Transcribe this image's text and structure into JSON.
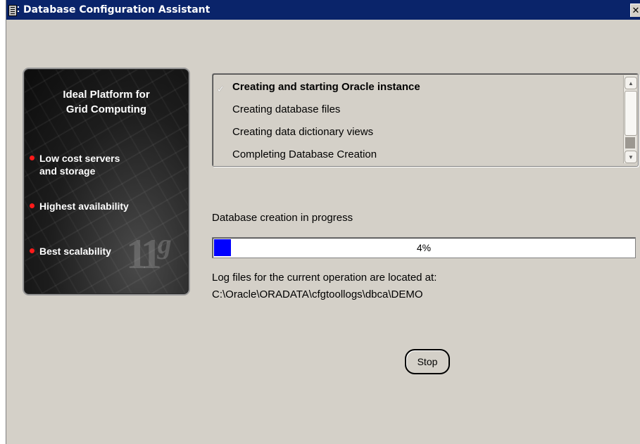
{
  "window": {
    "title": "Database Configuration Assistant",
    "close_glyph": "✕"
  },
  "promo": {
    "title_line1": "Ideal Platform for",
    "title_line2": "Grid Computing",
    "bullets": [
      {
        "line1": "Low cost servers",
        "line2": "and storage"
      },
      {
        "line1": "Highest availability",
        "line2": ""
      },
      {
        "line1": "Best scalability",
        "line2": ""
      }
    ],
    "logo_main": "11",
    "logo_sup": "g",
    "bullet_color": "#ff1a1a"
  },
  "steps": [
    {
      "label": "Creating and starting Oracle instance",
      "state": "active"
    },
    {
      "label": "Creating database files",
      "state": "pending"
    },
    {
      "label": "Creating data dictionary views",
      "state": "pending"
    },
    {
      "label": "Completing Database Creation",
      "state": "pending"
    }
  ],
  "progress": {
    "status_label": "Database creation in progress",
    "percent_text": "4%",
    "percent": 4,
    "fill_color": "#0000ff"
  },
  "log": {
    "line1": "Log files for the current operation are located at:",
    "line2": "C:\\Oracle\\ORADATA\\cfgtoollogs\\dbca\\DEMO"
  },
  "buttons": {
    "stop_label": "Stop"
  },
  "colors": {
    "titlebar": "#0a246a",
    "window_bg": "#d4d0c8"
  }
}
